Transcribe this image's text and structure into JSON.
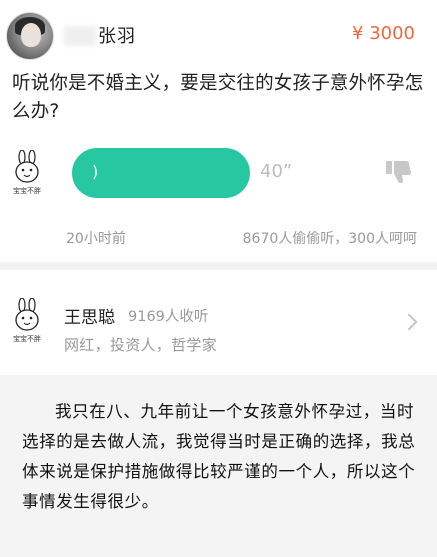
{
  "header": {
    "asker_name": "张羽",
    "price": "¥ 3000"
  },
  "question": {
    "text": "听说你是不婚主义，要是交往的女孩子意外怀孕怎么办?"
  },
  "voice": {
    "duration": "40”",
    "wave_glyph": ")",
    "posted": "20小时前",
    "stats": "8670人偷偷听，300人呵呵"
  },
  "answerer": {
    "name": "王思聪",
    "listeners": "9169人收听",
    "tags": "网红，投资人，哲学家"
  },
  "icons": {
    "rabbit_caption": "宝宝不胖"
  },
  "quote": {
    "text": "我只在八、九年前让一个女孩意外怀孕过，当时选择的是去做人流，我觉得当时是正确的选择，我总体来说是保护措施做得比较严谨的一个人，所以这个事情发生得很少。"
  },
  "colors": {
    "accent_green": "#27c7a2",
    "price_orange": "#f0673b"
  }
}
